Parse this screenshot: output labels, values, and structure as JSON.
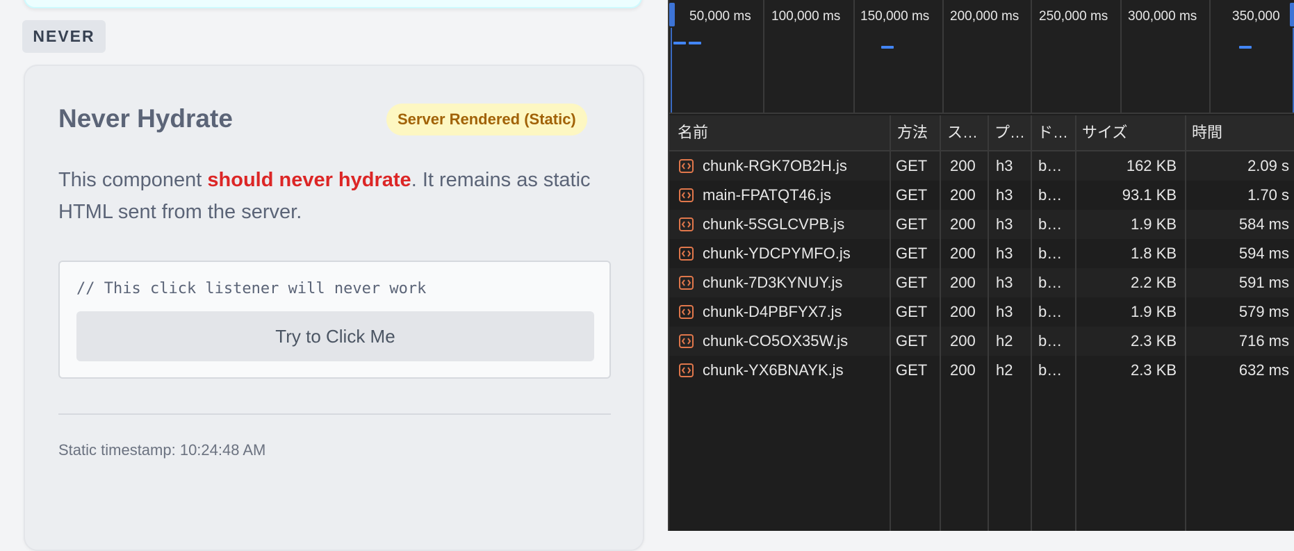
{
  "left": {
    "section_tag": "NEVER",
    "card": {
      "title": "Never Hydrate",
      "badge": "Server Rendered (Static)",
      "desc_before": "This component ",
      "desc_highlight": "should never hydrate",
      "desc_after": ". It remains as static HTML sent from the server.",
      "code_comment": "// This click listener will never work",
      "button_label": "Try to Click Me",
      "timestamp": "Static timestamp: 10:24:48 AM"
    }
  },
  "devtools": {
    "overview_ticks": [
      "50,000 ms",
      "100,000 ms",
      "150,000 ms",
      "200,000 ms",
      "250,000 ms",
      "300,000 ms",
      "350,000"
    ],
    "columns": [
      "名前",
      "方法",
      "ス…",
      "プ…",
      "ド…",
      "サイズ",
      "時間"
    ],
    "requests": [
      {
        "name": "chunk-RGK7OB2H.js",
        "method": "GET",
        "status": "200",
        "protocol": "h3",
        "domain": "b…",
        "size": "162 KB",
        "time": "2.09 s"
      },
      {
        "name": "main-FPATQT46.js",
        "method": "GET",
        "status": "200",
        "protocol": "h3",
        "domain": "b…",
        "size": "93.1 KB",
        "time": "1.70 s"
      },
      {
        "name": "chunk-5SGLCVPB.js",
        "method": "GET",
        "status": "200",
        "protocol": "h3",
        "domain": "b…",
        "size": "1.9 KB",
        "time": "584 ms"
      },
      {
        "name": "chunk-YDCPYMFO.js",
        "method": "GET",
        "status": "200",
        "protocol": "h3",
        "domain": "b…",
        "size": "1.8 KB",
        "time": "594 ms"
      },
      {
        "name": "chunk-7D3KYNUY.js",
        "method": "GET",
        "status": "200",
        "protocol": "h3",
        "domain": "b…",
        "size": "2.2 KB",
        "time": "591 ms"
      },
      {
        "name": "chunk-D4PBFYX7.js",
        "method": "GET",
        "status": "200",
        "protocol": "h3",
        "domain": "b…",
        "size": "1.9 KB",
        "time": "579 ms"
      },
      {
        "name": "chunk-CO5OX35W.js",
        "method": "GET",
        "status": "200",
        "protocol": "h2",
        "domain": "b…",
        "size": "2.3 KB",
        "time": "716 ms"
      },
      {
        "name": "chunk-YX6BNAYK.js",
        "method": "GET",
        "status": "200",
        "protocol": "h2",
        "domain": "b…",
        "size": "2.3 KB",
        "time": "632 ms"
      }
    ],
    "file_icon": "script-file-icon",
    "colors": {
      "accent": "#4285f4",
      "icon": "#e0774b",
      "highlight": "#dc2626",
      "badge_text": "#a16207"
    }
  }
}
